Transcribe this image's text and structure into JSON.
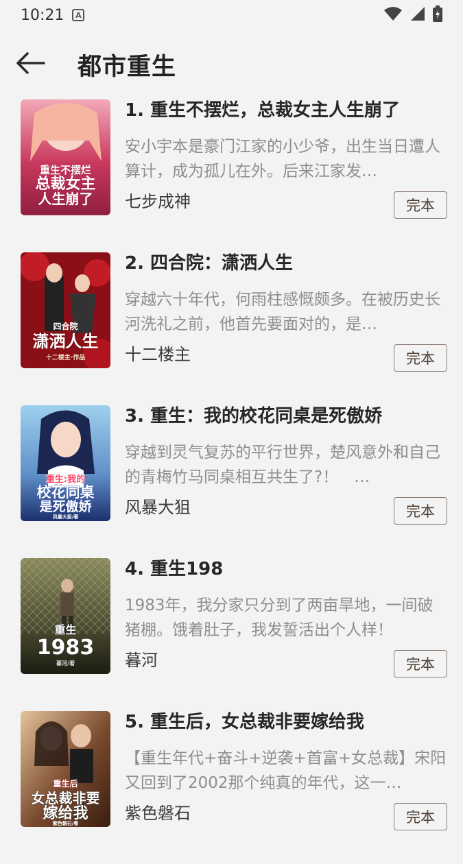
{
  "status_bar": {
    "time": "10:21",
    "badge": "A"
  },
  "header": {
    "title": "都市重生",
    "back_icon": "back-arrow-icon"
  },
  "books": [
    {
      "title": "1. 重生不摆烂，总裁女主人生崩了",
      "description": "安小宇本是豪门江家的小少爷，出生当日遭人算计，成为孤儿在外。后来江家发…",
      "author": "七步成神",
      "status": "完本",
      "cover_lines": [
        "重生不摆烂",
        "总裁女主",
        "人生崩了"
      ],
      "cover_colors": [
        "#f2a9b8",
        "#c8385d",
        "#8f1f3f"
      ]
    },
    {
      "title": "2. 四合院：潇洒人生",
      "description": "穿越六十年代，何雨柱感慨颇多。在被历史长河洗礼之前，他首先要面对的，是…",
      "author": "十二楼主",
      "status": "完本",
      "cover_lines": [
        "四合院",
        "潇洒人生",
        "十二楼主·作品"
      ],
      "cover_colors": [
        "#6b0f14",
        "#b5161f",
        "#3d0508"
      ]
    },
    {
      "title": "3. 重生：我的校花同桌是死傲娇",
      "description": "穿越到灵气复苏的平行世界，楚风意外和自己的青梅竹马同桌相互共生了?！　…",
      "author": "风暴大狙",
      "status": "完本",
      "cover_lines": [
        "重生:我的",
        "校花同桌",
        "是死傲娇",
        "风暴大狙/著"
      ],
      "cover_colors": [
        "#8fc4e6",
        "#3c6fb0",
        "#1c2f6e"
      ]
    },
    {
      "title": "4. 重生198",
      "description": "1983年，我分家只分到了两亩旱地，一间破猪棚。饿着肚子，我发誓活出个人样！",
      "author": "暮河",
      "status": "完本",
      "cover_lines": [
        "重生",
        "1983",
        "暮河/著"
      ],
      "cover_colors": [
        "#6a6a45",
        "#3a3a26",
        "#1c1c12"
      ]
    },
    {
      "title": "5. 重生后，女总裁非要嫁给我",
      "description": "【重生年代+奋斗+逆袭+首富+女总裁】宋阳又回到了2002那个纯真的年代，这一…",
      "author": "紫色磐石",
      "status": "完本",
      "cover_lines": [
        "重生后",
        "女总裁非要",
        "嫁给我",
        "紫色磐石/著"
      ],
      "cover_colors": [
        "#d9b48a",
        "#7a4a2e",
        "#3a1d10"
      ]
    }
  ]
}
